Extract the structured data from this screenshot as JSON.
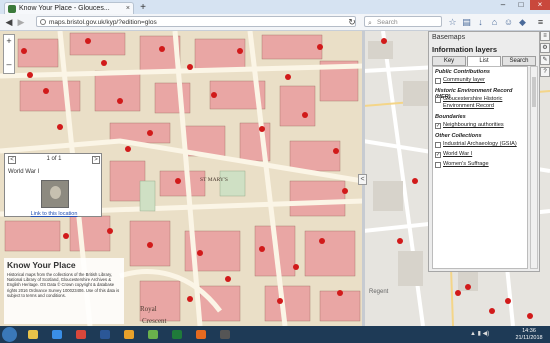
{
  "browser": {
    "tab_title": "Know Your Place - Glouces...",
    "tab_close": "×",
    "new_tab": "+",
    "url": "maps.bristol.gov.uk/kyp/?edition=glos",
    "search_placeholder": "Search",
    "window_buttons": [
      "–",
      "□",
      "×"
    ],
    "nav": {
      "back": "◀",
      "forward": "▶",
      "refresh": "↻"
    },
    "toolbar_icons": [
      "star-icon",
      "clipboard-icon",
      "download-icon",
      "home-icon",
      "chat-icon",
      "shield-icon",
      "menu-icon"
    ]
  },
  "map": {
    "zoom_in": "+",
    "zoom_out": "–",
    "splitter": "<",
    "popup": {
      "count": "1 of 1",
      "prev": "<",
      "next": ">",
      "title": "World War I",
      "link": "Link to this location"
    },
    "kyp": {
      "name": "Know Your Place",
      "attribution": "Historical maps from the collections of the British Library, National Library of Scotland, Gloucestershire Archives & English Heritage. OS Data © Crown copyright & database rights 2016 Ordnance Survey 100023406. Use of this data is subject to terms and conditions."
    },
    "tools": [
      "≡",
      "⚙",
      "✎",
      "?"
    ]
  },
  "panel": {
    "basemaps": "Basemaps",
    "header": "Information layers",
    "tabs": [
      "Key",
      "List",
      "Search"
    ],
    "active_tab": "List",
    "sections": [
      {
        "title": "Public Contributions",
        "items": [
          {
            "label": "Community layer",
            "checked": false
          }
        ]
      },
      {
        "title": "Historic Environment Record (HER)",
        "items": [
          {
            "label": "Gloucestershire Historic Environment Record",
            "checked": false
          }
        ]
      },
      {
        "title": "Boundaries",
        "items": [
          {
            "label": "Neighbouring authorities",
            "checked": true
          }
        ]
      },
      {
        "title": "Other Collections",
        "items": [
          {
            "label": "Industrial Archaeology (GSIA)",
            "checked": false
          },
          {
            "label": "World War I",
            "checked": true
          },
          {
            "label": "Women's Suffrage",
            "checked": false
          }
        ]
      }
    ],
    "check_mark": "✓"
  },
  "taskbar": {
    "clock_time": "14:36",
    "clock_date": "21/11/2018",
    "apps": [
      {
        "name": "explorer-icon",
        "color": "#e8c34a"
      },
      {
        "name": "ie-icon",
        "color": "#3a8ee6"
      },
      {
        "name": "chrome-icon",
        "color": "#d9473b"
      },
      {
        "name": "word-icon",
        "color": "#2b5797"
      },
      {
        "name": "outlook-icon",
        "color": "#e8a12a"
      },
      {
        "name": "paint-icon",
        "color": "#6ab04c"
      },
      {
        "name": "excel-icon",
        "color": "#1f7a3a"
      },
      {
        "name": "firefox-icon",
        "color": "#e66a1f"
      },
      {
        "name": "terminal-icon",
        "color": "#555555"
      }
    ]
  },
  "colors": {
    "accent": "#1f4fb5",
    "map_marker": "#d11a1a"
  }
}
